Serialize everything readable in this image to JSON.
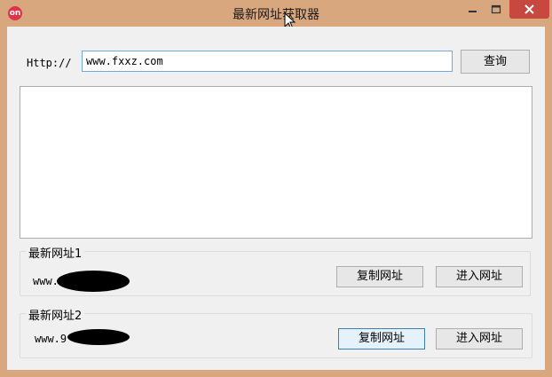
{
  "window": {
    "title": "最新网址获取器",
    "icon_text": "on",
    "minimize_glyph": "—",
    "maximize_glyph": "□",
    "close_glyph": "✕"
  },
  "colors": {
    "frame": "#d9a77e",
    "client": "#f0f0f0",
    "close_button": "#c7483f",
    "focus_border": "#7aa7d9"
  },
  "query": {
    "label": "Http://",
    "value": "www.fxxz.com",
    "button_label": "查询"
  },
  "result": {
    "text": ""
  },
  "group1": {
    "legend": "最新网址1",
    "url_visible": "www.",
    "copy_label": "复制网址",
    "go_label": "进入网址"
  },
  "group2": {
    "legend": "最新网址2",
    "url_visible": "www.9",
    "copy_label": "复制网址",
    "go_label": "进入网址"
  }
}
